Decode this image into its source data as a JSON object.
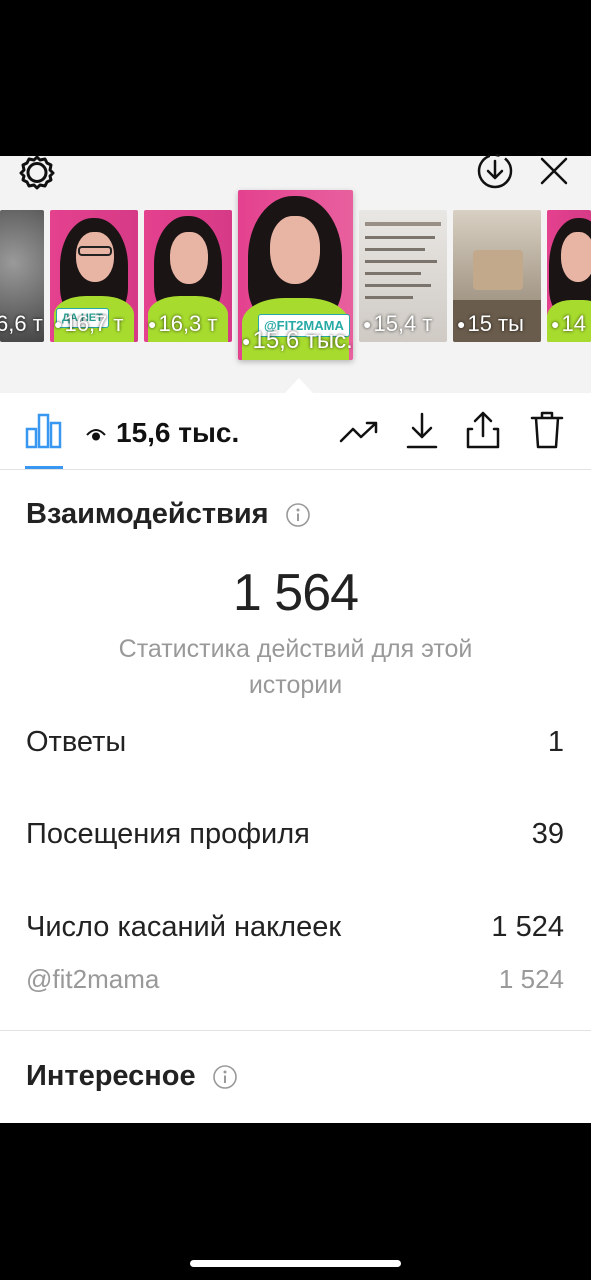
{
  "viewer": {
    "thumbnails": [
      {
        "views": "6,6 т",
        "kind": "blur"
      },
      {
        "views": "16,7 т",
        "kind": "portrait",
        "sticker": "ДА НЕТ"
      },
      {
        "views": "16,3 т",
        "kind": "portrait",
        "sticker": ""
      },
      {
        "views": "15,6 тыс.",
        "kind": "portrait-main",
        "sticker": "@FIT2MAMA"
      },
      {
        "views": "15,4 т",
        "kind": "text",
        "sticker": ""
      },
      {
        "views": "15 ты",
        "kind": "room",
        "sticker": ""
      },
      {
        "views": "14",
        "kind": "portrait",
        "sticker": ""
      }
    ],
    "icons": [
      "gear-icon",
      "download-circle-icon",
      "close-icon"
    ]
  },
  "toolbar": {
    "views": "15,6 тыс.",
    "icons": [
      "bar-chart-icon",
      "eye-icon",
      "trend-icon",
      "download-icon",
      "share-icon",
      "trash-icon"
    ],
    "accent": "#3897f0"
  },
  "interactions": {
    "title": "Взаимодействия",
    "total": "1 564",
    "subtitle": "Статистика действий для этой истории",
    "rows": [
      {
        "label": "Ответы",
        "value": "1"
      },
      {
        "label": "Посещения профиля",
        "value": "39"
      },
      {
        "label": "Число касаний наклеек",
        "value": "1 524"
      }
    ],
    "sub_row": {
      "label": "@fit2mama",
      "value": "1 524"
    }
  },
  "discovery": {
    "title": "Интересное"
  }
}
